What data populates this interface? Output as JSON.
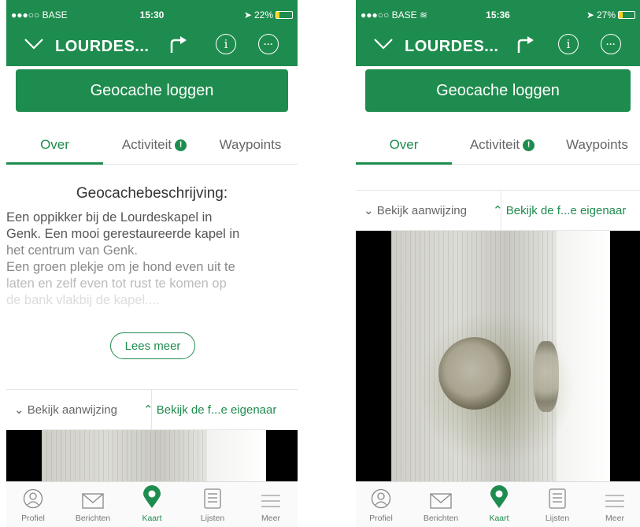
{
  "colors": {
    "brand_green": "#1e8c4e",
    "battery_yellow": "#f5d516"
  },
  "left": {
    "status": {
      "carrier": "●●●○○ BASE",
      "time": "15:30",
      "battery_text": "22%",
      "battery_level": 0.22
    },
    "nav": {
      "title": "LOURDES..."
    },
    "log_button": "Geocache loggen",
    "tabs": [
      {
        "label": "Over",
        "active": true
      },
      {
        "label": "Activiteit",
        "badge": "!"
      },
      {
        "label": "Waypoints"
      }
    ],
    "description": {
      "heading": "Geocachebeschrijving:",
      "line1": "Een oppikker bij de Lourdeskapel in",
      "line2": "Genk. Een mooi gerestaureerde kapel in",
      "line3": "het centrum van Genk.",
      "line4": "Een groen plekje om je hond even uit te",
      "line5": "laten en zelf even tot rust te komen op",
      "line6": "de bank vlakbij de kapel...."
    },
    "read_more": "Lees meer",
    "hint": {
      "left": "Bekijk aanwijzing",
      "right": "Bekijk de f...e eigenaar"
    },
    "tabbar": [
      {
        "label": "Profiel",
        "icon": "profile-icon"
      },
      {
        "label": "Berichten",
        "icon": "mail-icon"
      },
      {
        "label": "Kaart",
        "icon": "map-pin-icon",
        "active": true
      },
      {
        "label": "Lijsten",
        "icon": "list-icon"
      },
      {
        "label": "Meer",
        "icon": "menu-icon"
      }
    ]
  },
  "right": {
    "status": {
      "carrier": "●●●○○ BASE",
      "time": "15:36",
      "battery_text": "27%",
      "battery_level": 0.27
    },
    "nav": {
      "title": "LOURDES..."
    },
    "log_button": "Geocache loggen",
    "tabs": [
      {
        "label": "Over",
        "active": true
      },
      {
        "label": "Activiteit",
        "badge": "!"
      },
      {
        "label": "Waypoints"
      }
    ],
    "hint": {
      "left": "Bekijk aanwijzing",
      "right": "Bekijk de f...e eigenaar"
    },
    "tabbar": [
      {
        "label": "Profiel",
        "icon": "profile-icon"
      },
      {
        "label": "Berichten",
        "icon": "mail-icon"
      },
      {
        "label": "Kaart",
        "icon": "map-pin-icon",
        "active": true
      },
      {
        "label": "Lijsten",
        "icon": "list-icon"
      },
      {
        "label": "Meer",
        "icon": "menu-icon"
      }
    ]
  }
}
